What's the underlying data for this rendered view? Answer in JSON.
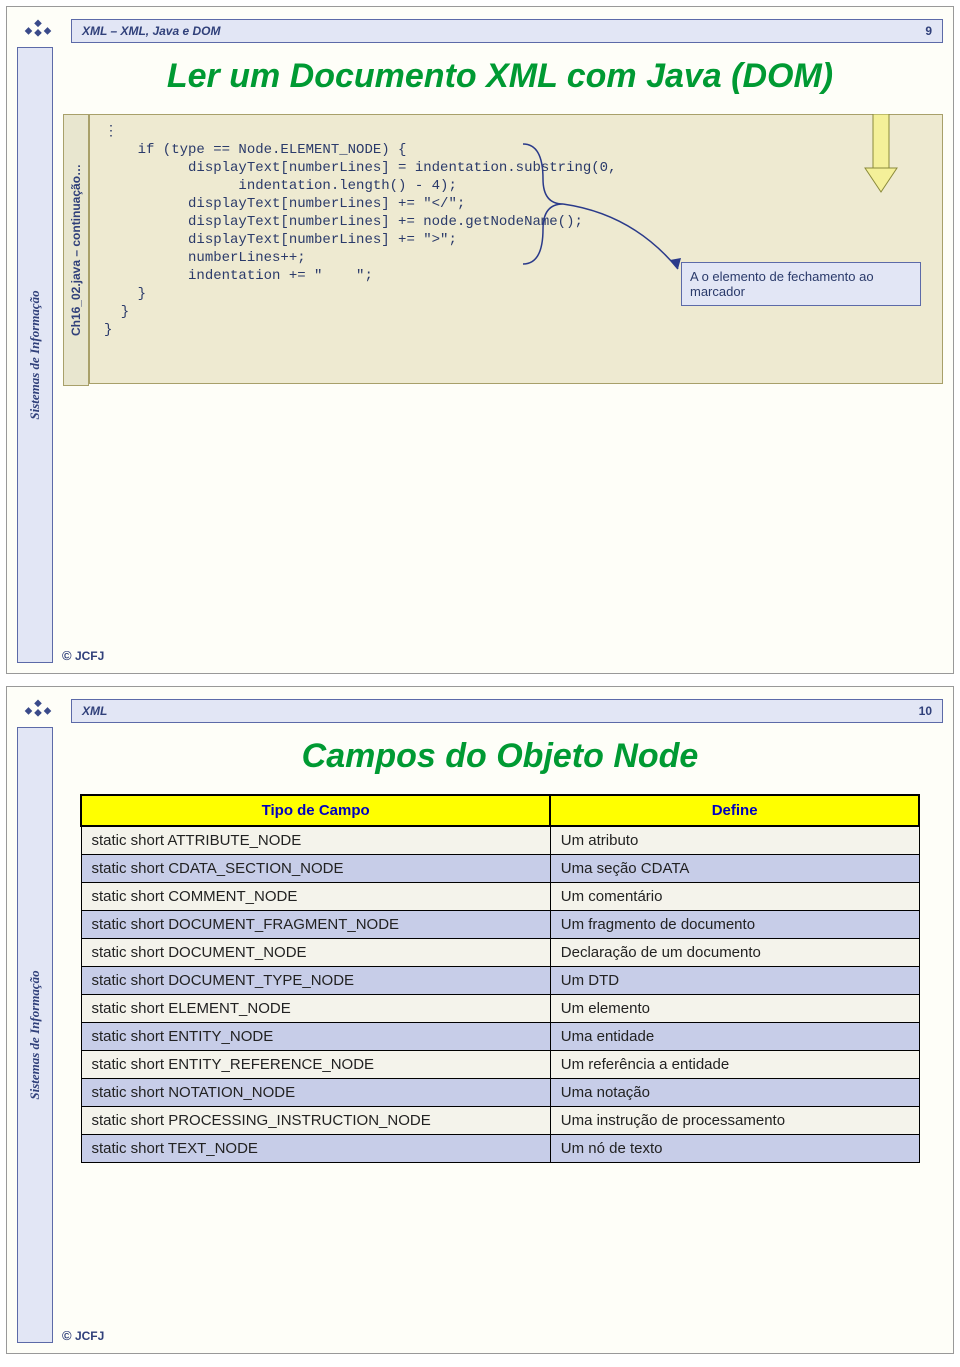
{
  "sidebar_label": "Sistemas de Informação",
  "footer": "JCFJ",
  "copyright": "©",
  "slide1": {
    "header_title": "XML – XML, Java e DOM",
    "page_num": "9",
    "title": "Ler um Documento XML com Java (DOM)",
    "file_label": "Ch16_02.java – continuação…",
    "code": "⋮\n    if (type == Node.ELEMENT_NODE) {\n          displayText[numberLines] = indentation.substring(0,\n                indentation.length() - 4);\n          displayText[numberLines] += \"</\";\n          displayText[numberLines] += node.getNodeName();\n          displayText[numberLines] += \">\";\n          numberLines++;\n          indentation += \"    \";\n    }\n  }\n}",
    "callout": "A o elemento de fechamento ao marcador"
  },
  "slide2": {
    "header_title": "XML",
    "page_num": "10",
    "title": "Campos do Objeto Node",
    "col1": "Tipo de Campo",
    "col2": "Define",
    "rows": [
      {
        "t": "static short ATTRIBUTE_NODE",
        "d": "Um atributo"
      },
      {
        "t": "static short CDATA_SECTION_NODE",
        "d": "Uma seção CDATA"
      },
      {
        "t": "static short COMMENT_NODE",
        "d": "Um comentário"
      },
      {
        "t": "static short  DOCUMENT_FRAGMENT_NODE",
        "d": "Um fragmento de documento"
      },
      {
        "t": "static short DOCUMENT_NODE",
        "d": "Declaração de um documento"
      },
      {
        "t": "static short DOCUMENT_TYPE_NODE",
        "d": "Um DTD"
      },
      {
        "t": "static short ELEMENT_NODE",
        "d": "Um elemento"
      },
      {
        "t": "static short ENTITY_NODE",
        "d": "Uma entidade"
      },
      {
        "t": "static short ENTITY_REFERENCE_NODE",
        "d": "Um referência a entidade"
      },
      {
        "t": "static short NOTATION_NODE",
        "d": "Uma notação"
      },
      {
        "t": "static short PROCESSING_INSTRUCTION_NODE",
        "d": "Uma instrução de processamento"
      },
      {
        "t": "static short TEXT_NODE",
        "d": "Um nó de texto"
      }
    ]
  }
}
